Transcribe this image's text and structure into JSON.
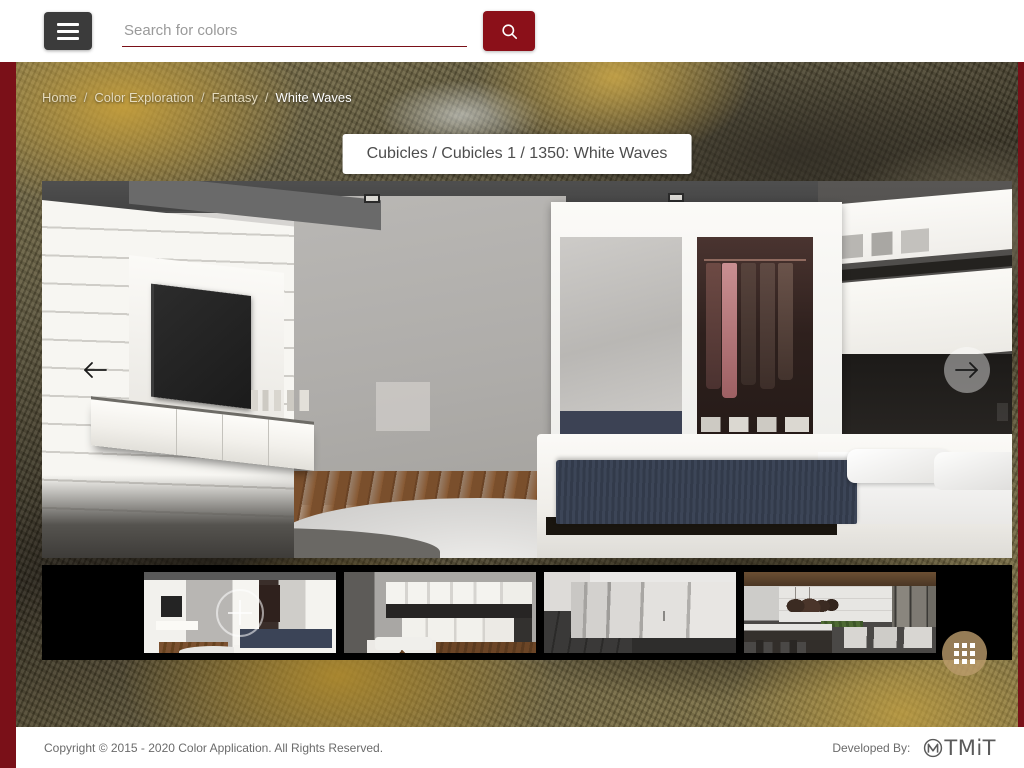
{
  "header": {
    "menu_button_label": "Menu",
    "menu_icon": "hamburger-icon",
    "search": {
      "value": "",
      "placeholder": "Search for colors",
      "button_icon": "search-icon",
      "button_label": "Search"
    }
  },
  "breadcrumb": {
    "items": [
      {
        "label": "Home",
        "active": false
      },
      {
        "label": "Color Exploration",
        "active": false
      },
      {
        "label": "Fantasy",
        "active": false
      },
      {
        "label": "White Waves",
        "active": true
      }
    ],
    "separator": "/"
  },
  "title_card": {
    "text": "Cubicles / Cubicles 1 / 1350: White Waves"
  },
  "viewer": {
    "prev_label": "Previous image",
    "prev_icon": "arrow-left-icon",
    "next_label": "Next image",
    "next_icon": "arrow-right-icon",
    "current_scene": "Bedroom with wardrobe, TV wall and platform bed"
  },
  "thumbnails": [
    {
      "name": "Bedroom",
      "active": true,
      "overlay_icon": "plus-circle-icon"
    },
    {
      "name": "Kitchen",
      "active": false,
      "overlay_icon": ""
    },
    {
      "name": "Cubicles",
      "active": false,
      "overlay_icon": ""
    },
    {
      "name": "Cafeteria",
      "active": false,
      "overlay_icon": ""
    }
  ],
  "fab": {
    "label": "Color palette grid",
    "icon": "apps-grid-icon"
  },
  "footer": {
    "copyright": "Copyright © 2015 - 2020 Color Application. All Rights Reserved.",
    "developed_by_label": "Developed By:",
    "developer_logo_text": "TMiT",
    "developer_logo_mark": "tmit-logo-icon"
  },
  "colors": {
    "accent_red": "#8b1019",
    "rail_red": "#7a1018",
    "header_bg": "#ffffff",
    "footer_bg": "#ffffff",
    "menu_button_bg": "#3b3b3b",
    "fab_bg": "#ba9b6b",
    "strip_bg": "#000000"
  }
}
